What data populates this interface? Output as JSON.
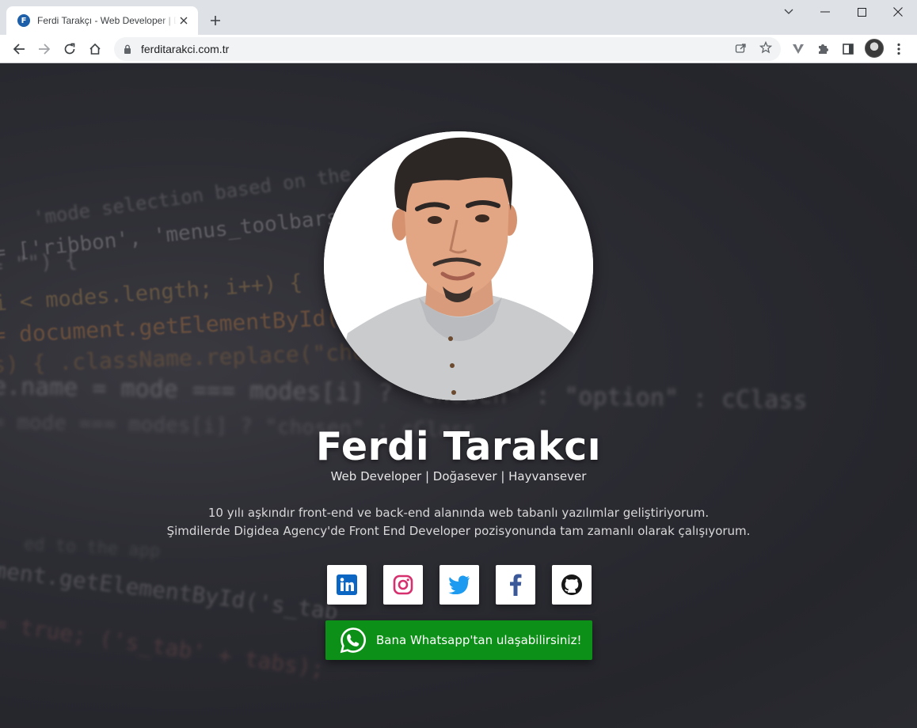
{
  "browser": {
    "tab_title": "Ferdi Tarakçı - Web Developer | Doğasever | Hayvansever",
    "favicon_letter": "F",
    "url": "ferditarakci.com.tr"
  },
  "background_code": [
    "'mode selection based on the app",
    "= ['ribbon', 'menus_toolbars', 'menu",
    "= \"\") {",
    "i < modes.length; i++) {",
    "= document.getElementById(mode",
    "s) {   .className.replace(\"cho",
    "e.name = mode === modes[i] ? \"chosen\" : \"option\" : cClass",
    "= mode === modes[i] ? \"chosen\" : cClass",
    "ed to the app",
    "ment.getElementById('s_tab",
    "= true;      ('s_tab' + tabs);"
  ],
  "profile": {
    "name": "Ferdi Tarakcı",
    "tagline": "Web Developer | Doğasever | Hayvansever",
    "bio_line_1": "10 yılı aşkındır front-end ve back-end alanında web tabanlı yazılımlar geliştiriyorum.",
    "bio_line_2": "Şimdilerde Digidea Agency'de Front End Developer pozisyonunda tam zamanlı olarak çalışıyorum."
  },
  "socials": [
    {
      "name": "linkedin",
      "icon": "linkedin-icon",
      "color": "#0a66c2"
    },
    {
      "name": "instagram",
      "icon": "instagram-icon",
      "color": "#d6306f"
    },
    {
      "name": "twitter",
      "icon": "twitter-icon",
      "color": "#1d9bf0"
    },
    {
      "name": "facebook",
      "icon": "facebook-icon",
      "color": "#3b5998"
    },
    {
      "name": "github",
      "icon": "github-icon",
      "color": "#181717"
    }
  ],
  "whatsapp": {
    "label": "Bana Whatsapp'tan ulaşabilirsiniz!",
    "icon": "whatsapp-icon",
    "color": "#0c9018"
  }
}
